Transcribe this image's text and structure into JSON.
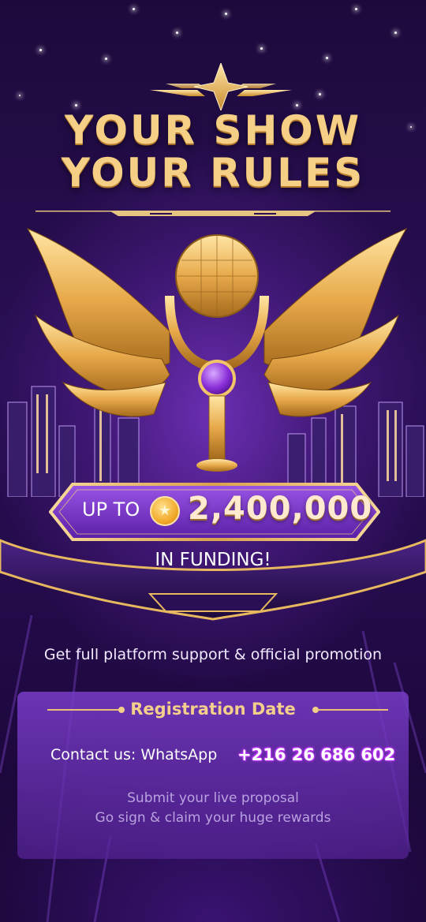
{
  "hero": {
    "title_line1": "YOUR SHOW",
    "title_line2": "YOUR RULES"
  },
  "funding_banner": {
    "prefix": "UP TO",
    "coin_icon": "gold-star-coin-icon",
    "amount": "2,400,000",
    "suffix": "IN FUNDING!"
  },
  "support_text": "Get full platform support & official promotion",
  "card": {
    "title": "Registration Date",
    "contact_label": "Contact us: WhatsApp",
    "phone": "+216 26 686 602",
    "note_line1": "Submit your live proposal",
    "note_line2": "Go sign & claim your huge rewards"
  },
  "colors": {
    "background": "#220a46",
    "gold": "#f3cf8b",
    "purple_accent": "#7a3ad0",
    "phone_glow": "#c33cf5"
  }
}
